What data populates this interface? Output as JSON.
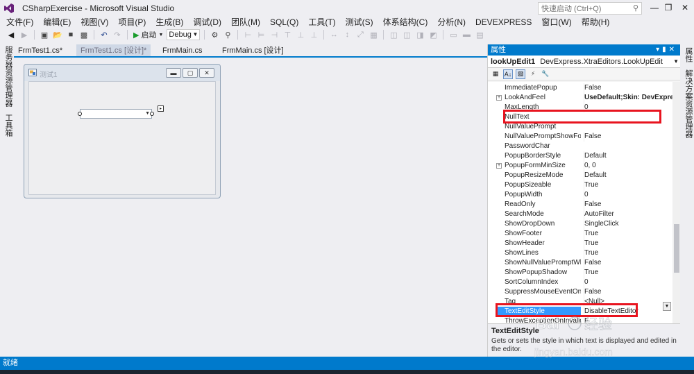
{
  "window": {
    "title": "CSharpExercise - Microsoft Visual Studio",
    "quick_launch_placeholder": "快速启动 (Ctrl+Q)"
  },
  "menu": [
    "文件(F)",
    "编辑(E)",
    "视图(V)",
    "项目(P)",
    "生成(B)",
    "调试(D)",
    "团队(M)",
    "SQL(Q)",
    "工具(T)",
    "测试(S)",
    "体系结构(C)",
    "分析(N)",
    "DEVEXPRESS",
    "窗口(W)",
    "帮助(H)"
  ],
  "toolbar": {
    "start_label": "启动",
    "config_value": "Debug"
  },
  "left_dock": {
    "tab1": "服务器资源管理器",
    "tab2": "工具箱"
  },
  "right_dock": {
    "tab1": "属性",
    "tab2": "解决方案资源管理器"
  },
  "doc_tabs": [
    "FrmTest1.cs*",
    "FrmTest1.cs [设计]*",
    "FrmMain.cs",
    "FrmMain.cs [设计]"
  ],
  "form": {
    "title": "测试1"
  },
  "properties": {
    "header": "属性",
    "object_name": "lookUpEdit1",
    "object_type": "DevExpress.XtraEditors.LookUpEdit",
    "rows": [
      {
        "name": "ImmediatePopup",
        "value": "False"
      },
      {
        "name": "LookAndFeel",
        "value": "UseDefault;Skin: DevExpress"
      },
      {
        "name": "MaxLength",
        "value": "0"
      },
      {
        "name": "NullText",
        "value": ""
      },
      {
        "name": "NullValuePrompt",
        "value": ""
      },
      {
        "name": "NullValuePromptShowFor",
        "value": "False"
      },
      {
        "name": "PasswordChar",
        "value": ""
      },
      {
        "name": "PopupBorderStyle",
        "value": "Default"
      },
      {
        "name": "PopupFormMinSize",
        "value": "0, 0"
      },
      {
        "name": "PopupResizeMode",
        "value": "Default"
      },
      {
        "name": "PopupSizeable",
        "value": "True"
      },
      {
        "name": "PopupWidth",
        "value": "0"
      },
      {
        "name": "ReadOnly",
        "value": "False"
      },
      {
        "name": "SearchMode",
        "value": "AutoFilter"
      },
      {
        "name": "ShowDropDown",
        "value": "SingleClick"
      },
      {
        "name": "ShowFooter",
        "value": "True"
      },
      {
        "name": "ShowHeader",
        "value": "True"
      },
      {
        "name": "ShowLines",
        "value": "True"
      },
      {
        "name": "ShowNullValuePromptWh",
        "value": "False"
      },
      {
        "name": "ShowPopupShadow",
        "value": "True"
      },
      {
        "name": "SortColumnIndex",
        "value": "0"
      },
      {
        "name": "SuppressMouseEventOnC",
        "value": "False"
      },
      {
        "name": "Tag",
        "value": "<Null>"
      },
      {
        "name": "TextEditStyle",
        "value": "DisableTextEditor"
      },
      {
        "name": "ThrowExceptionOnInvalid",
        "value": "F"
      }
    ],
    "description_title": "TextEditStyle",
    "description_text": "Gets or sets the style in which text is displayed and edited in the editor."
  },
  "status": {
    "text": "就绪"
  },
  "watermark": {
    "brand": "Bai",
    "brand2": "经验",
    "url": "jingyan.baidu.com"
  }
}
